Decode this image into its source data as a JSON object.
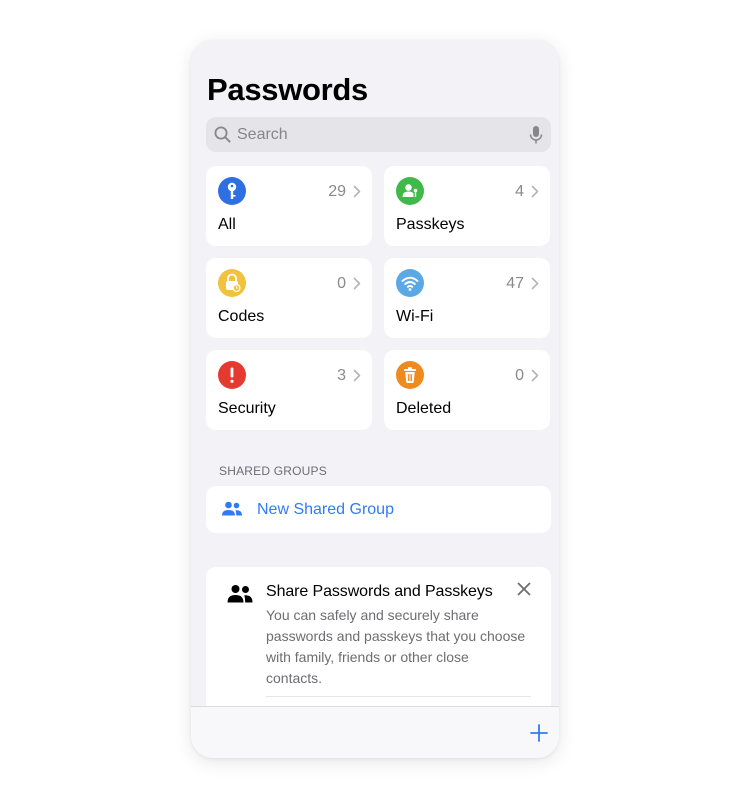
{
  "header": {
    "title": "Passwords"
  },
  "search": {
    "placeholder": "Search"
  },
  "categories": [
    {
      "label": "All",
      "count": "29",
      "icon": "key-icon",
      "color": "#2f6fe4"
    },
    {
      "label": "Passkeys",
      "count": "4",
      "icon": "person-key-icon",
      "color": "#3fb948"
    },
    {
      "label": "Codes",
      "count": "0",
      "icon": "lock-clock-icon",
      "color": "#f2c13d"
    },
    {
      "label": "Wi-Fi",
      "count": "47",
      "icon": "wifi-icon",
      "color": "#5aa9e6"
    },
    {
      "label": "Security",
      "count": "3",
      "icon": "exclamation-icon",
      "color": "#e53a2f"
    },
    {
      "label": "Deleted",
      "count": "0",
      "icon": "trash-icon",
      "color": "#ef8a1f"
    }
  ],
  "shared_groups": {
    "header": "SHARED GROUPS",
    "new_group_label": "New Shared Group",
    "accent": "#2f7bf6"
  },
  "share_card": {
    "title": "Share Passwords and Passkeys",
    "body": "You can safely and securely share passwords and passkeys that you choose with family, friends or other close contacts."
  },
  "toolbar": {
    "add_icon": "plus-icon"
  }
}
